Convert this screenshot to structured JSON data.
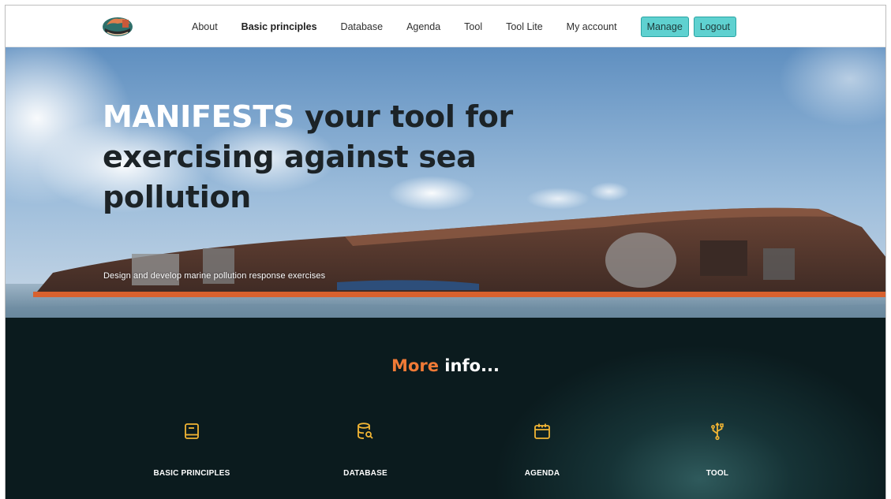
{
  "nav": {
    "items": [
      "About",
      "Basic principles",
      "Database",
      "Agenda",
      "Tool",
      "Tool Lite",
      "My account"
    ],
    "manage_label": "Manage",
    "logout_label": "Logout"
  },
  "hero": {
    "title_white": "MANIFESTS",
    "title_rest": " your tool for exercising against sea pollution",
    "subtitle": "Design and develop marine pollution response exercises"
  },
  "info": {
    "title_orange": "More",
    "title_rest": " info...",
    "cards": [
      {
        "label": "BASIC PRINCIPLES",
        "icon": "book-icon"
      },
      {
        "label": "DATABASE",
        "icon": "database-search-icon"
      },
      {
        "label": "AGENDA",
        "icon": "calendar-icon"
      },
      {
        "label": "TOOL",
        "icon": "usb-icon"
      }
    ]
  },
  "colors": {
    "accent_button": "#5fd1d0",
    "info_background": "#0b1b1e",
    "orange": "#f07a36",
    "icon_yellow": "#f2b534"
  }
}
